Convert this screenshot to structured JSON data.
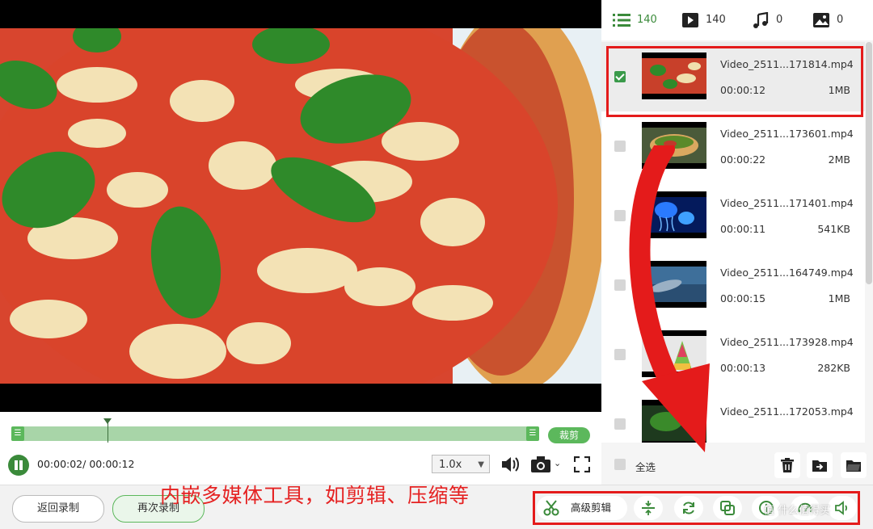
{
  "player": {
    "time": "00:00:02/ 00:00:12",
    "speed": "1.0x",
    "crop_label": "裁剪"
  },
  "bottom_bar": {
    "back_label": "返回录制",
    "again_label": "再次录制",
    "caption": "内嵌多媒体工具，如剪辑、压缩等",
    "advanced_edit_label": "高级剪辑",
    "watermark": "值 什么值得买"
  },
  "filter_tabs": {
    "all_count": "140",
    "video_count": "140",
    "audio_count": "0",
    "image_count": "0"
  },
  "media_items": [
    {
      "name": "Video_2511...171814.mp4",
      "duration": "00:00:12",
      "size": "1MB",
      "selected": true,
      "thumb": "pizza"
    },
    {
      "name": "Video_2511...173601.mp4",
      "duration": "00:00:22",
      "size": "2MB",
      "selected": false,
      "thumb": "tacos"
    },
    {
      "name": "Video_2511...171401.mp4",
      "duration": "00:00:11",
      "size": "541KB",
      "selected": false,
      "thumb": "jellyfish"
    },
    {
      "name": "Video_2511...164749.mp4",
      "duration": "00:00:15",
      "size": "1MB",
      "selected": false,
      "thumb": "dolphin"
    },
    {
      "name": "Video_2511...173928.mp4",
      "duration": "00:00:13",
      "size": "282KB",
      "selected": false,
      "thumb": "cake"
    },
    {
      "name": "Video_2511...172053.mp4",
      "duration": "",
      "size": "",
      "selected": false,
      "thumb": "greens"
    }
  ],
  "footer": {
    "select_all_label": "全选"
  },
  "colors": {
    "accent_green": "#3a8a3a",
    "highlight_red": "#e41b1b"
  },
  "icons": [
    "list-icon",
    "video-icon",
    "music-icon",
    "image-icon",
    "pause-icon",
    "volume-icon",
    "camera-icon",
    "fullscreen-icon",
    "scissors-icon",
    "compress-icon",
    "rotate-icon",
    "merge-icon",
    "info-icon",
    "speed-icon",
    "audio-icon",
    "trash-icon",
    "export-icon",
    "folder-icon"
  ]
}
